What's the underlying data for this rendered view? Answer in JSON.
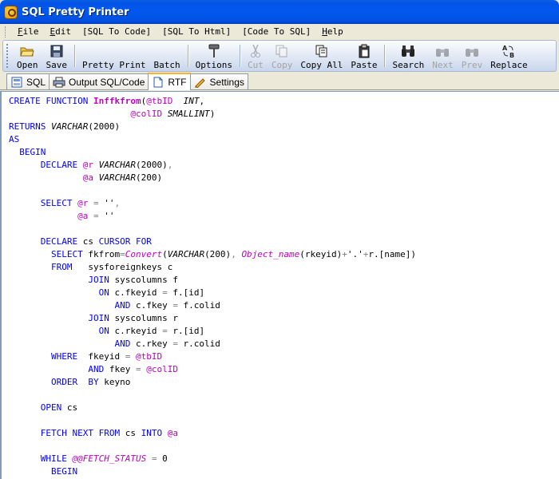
{
  "window": {
    "title": "SQL Pretty Printer"
  },
  "menu": [
    {
      "label": "File",
      "ul": "F",
      "rest": "ile"
    },
    {
      "label": "Edit",
      "ul": "E",
      "rest": "dit"
    },
    {
      "label": "[SQL To Code]",
      "ul": "",
      "rest": "[SQL To Code]"
    },
    {
      "label": "[SQL To Html]",
      "ul": "",
      "rest": "[SQL To Html]"
    },
    {
      "label": "[Code To SQL]",
      "ul": "",
      "rest": "[Code To SQL]"
    },
    {
      "label": "Help",
      "ul": "H",
      "rest": "elp"
    }
  ],
  "toolbar": {
    "open": "Open",
    "save": "Save",
    "pretty_print": "Pretty Print",
    "batch": "Batch",
    "options": "Options",
    "cut": "Cut",
    "copy": "Copy",
    "copy_all": "Copy All",
    "paste": "Paste",
    "search": "Search",
    "next": "Next",
    "prev": "Prev",
    "replace": "Replace"
  },
  "tabs": [
    {
      "label": "SQL",
      "active": false
    },
    {
      "label": "Output SQL/Code",
      "active": false
    },
    {
      "label": "RTF",
      "active": true
    },
    {
      "label": "Settings",
      "active": false
    }
  ],
  "code_lines": [
    [
      [
        "k",
        "CREATE FUNCTION "
      ],
      [
        "fb",
        "Inffkfrom"
      ],
      [
        "",
        "("
      ],
      [
        "v",
        "@tbID"
      ],
      [
        "",
        "  "
      ],
      [
        "t",
        "INT"
      ],
      [
        "",
        ","
      ]
    ],
    [
      [
        "",
        "                       "
      ],
      [
        "v",
        "@colID"
      ],
      [
        "t",
        " SMALLINT"
      ],
      [
        "",
        ")"
      ]
    ],
    [
      [
        "k",
        "RETURNS "
      ],
      [
        "t",
        "VARCHAR"
      ],
      [
        "",
        "(2000)"
      ]
    ],
    [
      [
        "k",
        "AS"
      ]
    ],
    [
      [
        "k",
        "  BEGIN"
      ]
    ],
    [
      [
        "",
        "      "
      ],
      [
        "k",
        "DECLARE "
      ],
      [
        "v",
        "@r"
      ],
      [
        "t",
        " VARCHAR"
      ],
      [
        "",
        "(2000)"
      ],
      [
        "o",
        ","
      ]
    ],
    [
      [
        "",
        "              "
      ],
      [
        "v",
        "@a"
      ],
      [
        "t",
        " VARCHAR"
      ],
      [
        "",
        "(200)"
      ]
    ],
    [
      [
        "",
        ""
      ]
    ],
    [
      [
        "",
        "      "
      ],
      [
        "k",
        "SELECT "
      ],
      [
        "v",
        "@r"
      ],
      [
        "o",
        " = "
      ],
      [
        "",
        "''"
      ],
      [
        "o",
        ","
      ]
    ],
    [
      [
        "",
        "             "
      ],
      [
        "v",
        "@a"
      ],
      [
        "o",
        " = "
      ],
      [
        "",
        "''"
      ]
    ],
    [
      [
        "",
        ""
      ]
    ],
    [
      [
        "",
        "      "
      ],
      [
        "k",
        "DECLARE "
      ],
      [
        "",
        "cs "
      ],
      [
        "k",
        "CURSOR FOR"
      ]
    ],
    [
      [
        "",
        "        "
      ],
      [
        "k",
        "SELECT "
      ],
      [
        "",
        "fkfrom"
      ],
      [
        "o",
        "="
      ],
      [
        "f",
        "Convert"
      ],
      [
        "",
        "("
      ],
      [
        "t",
        "VARCHAR"
      ],
      [
        "",
        "(200)"
      ],
      [
        "o",
        ", "
      ],
      [
        "f",
        "Object_name"
      ],
      [
        "",
        "(rkeyid)"
      ],
      [
        "o",
        "+"
      ],
      [
        "",
        "'.'"
      ],
      [
        "o",
        "+"
      ],
      [
        "",
        "r.[name])"
      ]
    ],
    [
      [
        "",
        "        "
      ],
      [
        "k",
        "FROM   "
      ],
      [
        "",
        "sysforeignkeys c"
      ]
    ],
    [
      [
        "",
        "               "
      ],
      [
        "k",
        "JOIN "
      ],
      [
        "",
        "syscolumns f"
      ]
    ],
    [
      [
        "",
        "                 "
      ],
      [
        "k",
        "ON "
      ],
      [
        "",
        "c.fkeyid "
      ],
      [
        "o",
        "="
      ],
      [
        "",
        " f.[id]"
      ]
    ],
    [
      [
        "",
        "                    "
      ],
      [
        "k",
        "AND "
      ],
      [
        "",
        "c.fkey "
      ],
      [
        "o",
        "="
      ],
      [
        "",
        " f.colid"
      ]
    ],
    [
      [
        "",
        "               "
      ],
      [
        "k",
        "JOIN "
      ],
      [
        "",
        "syscolumns r"
      ]
    ],
    [
      [
        "",
        "                 "
      ],
      [
        "k",
        "ON "
      ],
      [
        "",
        "c.rkeyid "
      ],
      [
        "o",
        "="
      ],
      [
        "",
        " r.[id]"
      ]
    ],
    [
      [
        "",
        "                    "
      ],
      [
        "k",
        "AND "
      ],
      [
        "",
        "c.rkey "
      ],
      [
        "o",
        "="
      ],
      [
        "",
        " r.colid"
      ]
    ],
    [
      [
        "",
        "        "
      ],
      [
        "k",
        "WHERE  "
      ],
      [
        "",
        "fkeyid "
      ],
      [
        "o",
        "="
      ],
      [
        "",
        " "
      ],
      [
        "v",
        "@tbID"
      ]
    ],
    [
      [
        "",
        "               "
      ],
      [
        "k",
        "AND "
      ],
      [
        "",
        "fkey "
      ],
      [
        "o",
        "="
      ],
      [
        "",
        " "
      ],
      [
        "v",
        "@colID"
      ]
    ],
    [
      [
        "",
        "        "
      ],
      [
        "k",
        "ORDER  BY "
      ],
      [
        "",
        "keyno"
      ]
    ],
    [
      [
        "",
        ""
      ]
    ],
    [
      [
        "",
        "      "
      ],
      [
        "k",
        "OPEN "
      ],
      [
        "",
        "cs"
      ]
    ],
    [
      [
        "",
        ""
      ]
    ],
    [
      [
        "",
        "      "
      ],
      [
        "k",
        "FETCH NEXT FROM "
      ],
      [
        "",
        "cs "
      ],
      [
        "k",
        "INTO "
      ],
      [
        "v",
        "@a"
      ]
    ],
    [
      [
        "",
        ""
      ]
    ],
    [
      [
        "",
        "      "
      ],
      [
        "k",
        "WHILE "
      ],
      [
        "f",
        "@@FETCH_STATUS"
      ],
      [
        "o",
        " = "
      ],
      [
        "",
        "0"
      ]
    ],
    [
      [
        "",
        "        "
      ],
      [
        "k",
        "BEGIN"
      ]
    ]
  ]
}
